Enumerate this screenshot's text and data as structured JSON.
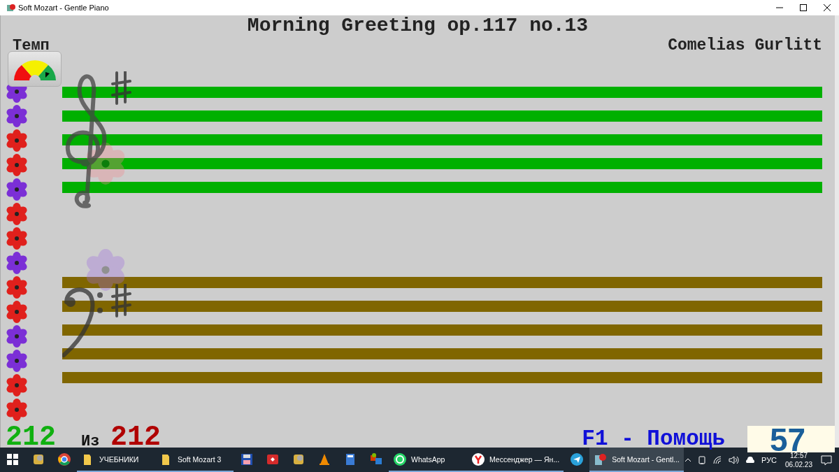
{
  "window": {
    "title": "Soft Mozart - Gentle Piano"
  },
  "piece": {
    "title": "Morning Greeting op.117 no.13",
    "composer": "Comelias Gurlitt"
  },
  "tempo": {
    "label": "Темп"
  },
  "flowers": [
    {
      "color": "#7b2fd6"
    },
    {
      "color": "#7b2fd6"
    },
    {
      "color": "#e0201c"
    },
    {
      "color": "#e0201c"
    },
    {
      "color": "#7b2fd6"
    },
    {
      "color": "#e0201c"
    },
    {
      "color": "#e0201c"
    },
    {
      "color": "#7b2fd6"
    },
    {
      "color": "#e0201c"
    },
    {
      "color": "#e0201c"
    },
    {
      "color": "#7b2fd6"
    },
    {
      "color": "#7b2fd6"
    },
    {
      "color": "#e0201c"
    },
    {
      "color": "#e0201c"
    }
  ],
  "staves": [
    {
      "kind": "treble",
      "color": "#00b000"
    },
    {
      "kind": "bass",
      "color": "#806600"
    }
  ],
  "footer": {
    "current": "212",
    "of": "Из",
    "total": "212",
    "help": "F1 - Помощь",
    "score": "57"
  },
  "taskbar": {
    "items": [
      {
        "kind": "start",
        "running": false,
        "selected": false
      },
      {
        "kind": "app",
        "running": false,
        "selected": false
      },
      {
        "kind": "chrome",
        "running": false,
        "selected": false
      },
      {
        "kind": "folder",
        "label": "УЧЕБНИКИ",
        "running": true,
        "selected": false
      },
      {
        "kind": "folder",
        "label": "Soft Mozart 3",
        "running": true,
        "selected": false
      },
      {
        "kind": "floppy",
        "running": false,
        "selected": false
      },
      {
        "kind": "red",
        "running": false,
        "selected": false
      },
      {
        "kind": "app",
        "running": false,
        "selected": false
      },
      {
        "kind": "cone",
        "running": false,
        "selected": false
      },
      {
        "kind": "calculator",
        "running": false,
        "selected": false
      },
      {
        "kind": "office",
        "running": false,
        "selected": false
      },
      {
        "kind": "whatsapp",
        "label": "WhatsApp",
        "running": true,
        "selected": false
      },
      {
        "kind": "yandex",
        "label": "Мессенджер — Ян...",
        "running": true,
        "selected": false
      },
      {
        "kind": "telegram",
        "running": false,
        "selected": false
      },
      {
        "kind": "mozart",
        "label": "Soft Mozart - Gentl...",
        "running": true,
        "selected": true
      }
    ],
    "language": "РУС",
    "time": "12:57",
    "date": "06.02.23"
  }
}
